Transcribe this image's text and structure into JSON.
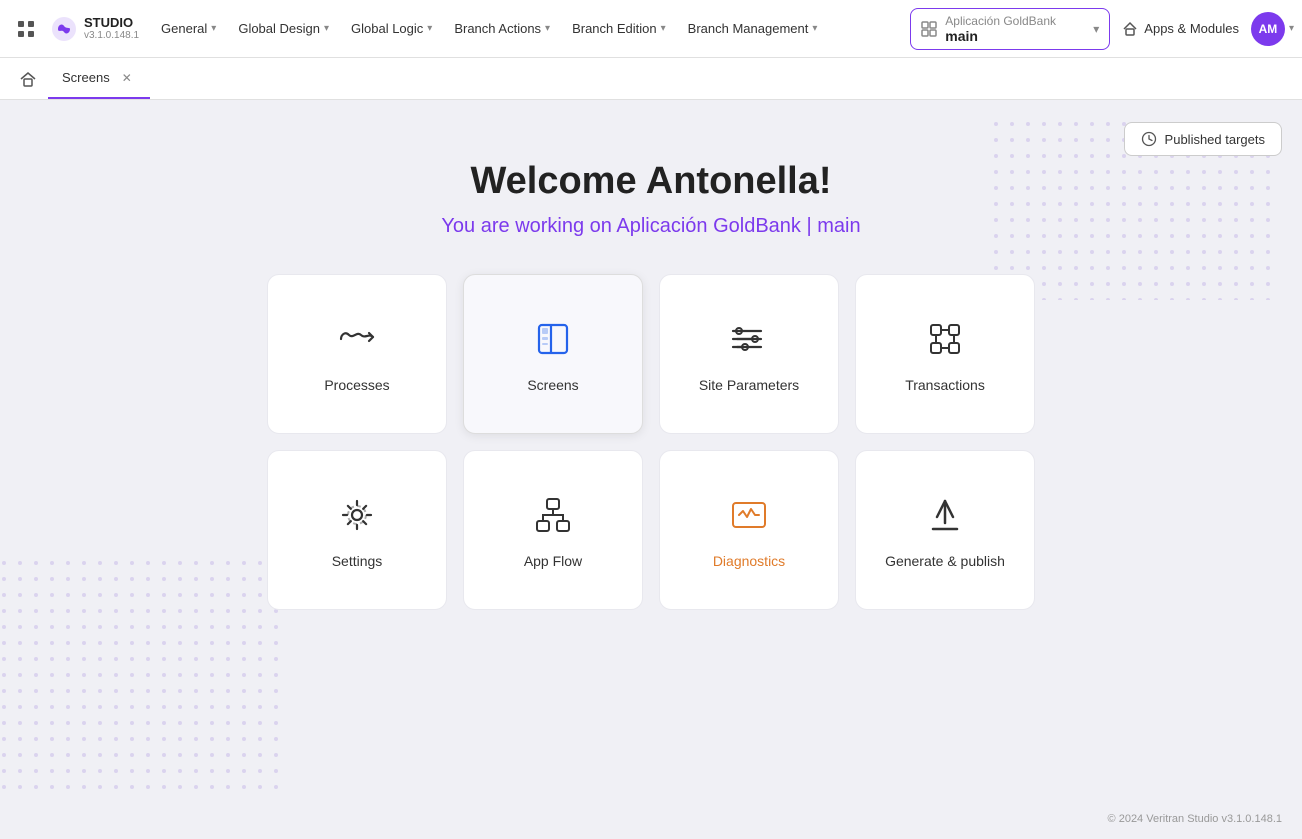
{
  "app": {
    "title": "STUDIO",
    "version": "v3.1.0.148.1"
  },
  "topnav": {
    "general_label": "General",
    "global_design_label": "Global Design",
    "global_logic_label": "Global Logic",
    "branch_actions_label": "Branch Actions",
    "branch_edition_label": "Branch Edition",
    "branch_management_label": "Branch Management",
    "app_name": "Aplicación GoldBank",
    "branch_name": "main",
    "apps_modules_label": "Apps & Modules",
    "avatar_initials": "AM"
  },
  "tabbar": {
    "screens_tab": "Screens"
  },
  "published_targets": {
    "label": "Published targets"
  },
  "welcome": {
    "title": "Welcome Antonella!",
    "subtitle": "You are working on Aplicación GoldBank | main"
  },
  "cards": [
    {
      "id": "processes",
      "label": "Processes",
      "icon": "processes"
    },
    {
      "id": "screens",
      "label": "Screens",
      "icon": "screens",
      "active": true
    },
    {
      "id": "site-parameters",
      "label": "Site Parameters",
      "icon": "site-parameters"
    },
    {
      "id": "transactions",
      "label": "Transactions",
      "icon": "transactions"
    },
    {
      "id": "settings",
      "label": "Settings",
      "icon": "settings"
    },
    {
      "id": "app-flow",
      "label": "App Flow",
      "icon": "app-flow"
    },
    {
      "id": "diagnostics",
      "label": "Diagnostics",
      "icon": "diagnostics"
    },
    {
      "id": "generate-publish",
      "label": "Generate & publish",
      "icon": "generate-publish"
    }
  ],
  "footer": {
    "text": "© 2024 Veritran Studio v3.1.0.148.1"
  }
}
